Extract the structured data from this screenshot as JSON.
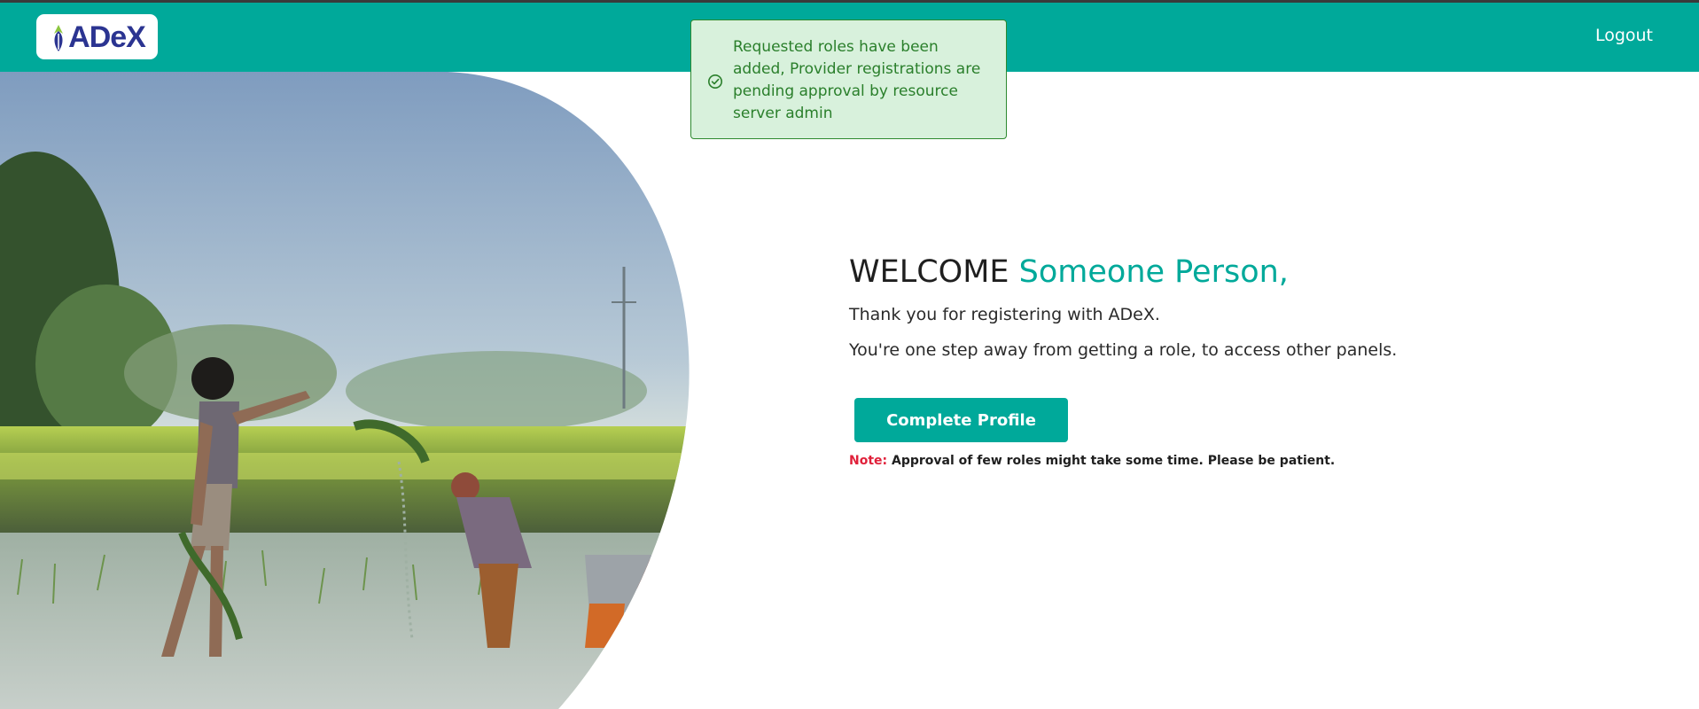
{
  "header": {
    "logo_text": "ADeX",
    "logout_label": "Logout",
    "colors": {
      "brand": "#00a99a",
      "logo_text": "#2b3491"
    }
  },
  "toast": {
    "message": "Requested roles have been added, Provider registrations are pending approval by resource server admin",
    "icon": "check-circle-icon",
    "colors": {
      "background": "#d8f1dc",
      "border": "#2d8a2f",
      "text": "#2a7f2b"
    }
  },
  "hero": {
    "icon": "farmers-rice-field-photo"
  },
  "main": {
    "welcome_prefix": "WELCOME",
    "user_name": "Someone Person,",
    "thank_you": "Thank you for registering with ADeX.",
    "subtitle": "You're one step away from getting a role, to access other panels.",
    "cta_label": "Complete Profile",
    "note_label": "Note:",
    "note_text": "Approval of few roles might take some time. Please be patient."
  }
}
